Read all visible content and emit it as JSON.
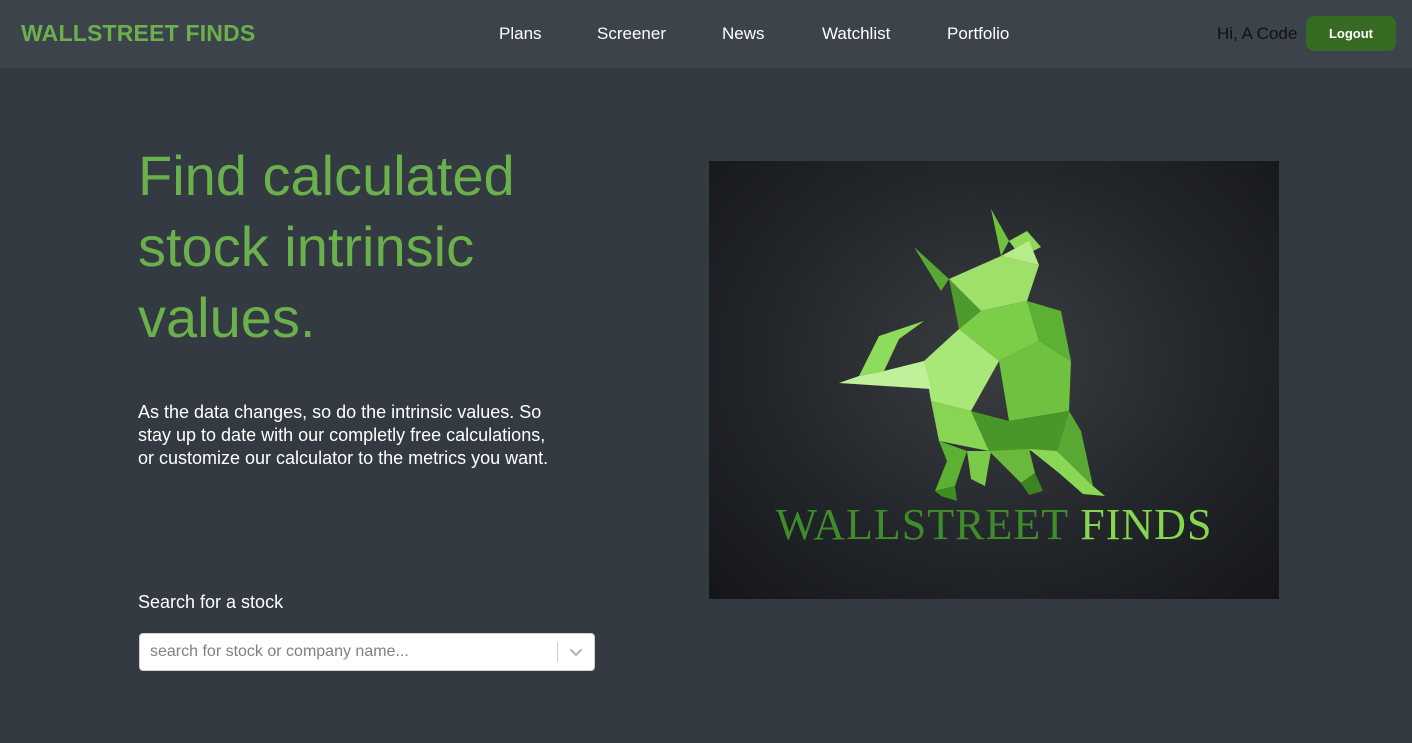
{
  "navbar": {
    "brand": "WALLSTREET FINDS",
    "links": [
      "Plans",
      "Screener",
      "News",
      "Watchlist",
      "Portfolio"
    ],
    "greeting": "Hi, A Code",
    "logout_label": "Logout"
  },
  "hero": {
    "title": "Find calculated stock intrinsic values.",
    "description": "As the data changes, so do the intrinsic values. So stay up to date with our completly free calculations, or customize our calculator to the metrics you want.",
    "search_label": "Search for a stock",
    "search_placeholder": "search for stock or company name...",
    "search_value": ""
  },
  "logo_image": {
    "icon": "polygonal-green-bull",
    "text_part1": "WALLSTREET",
    "text_part2": "FINDS"
  },
  "colors": {
    "accent": "#6ab04c",
    "button": "#356b22",
    "background": "#343a41",
    "navbar": "#3c434b"
  }
}
